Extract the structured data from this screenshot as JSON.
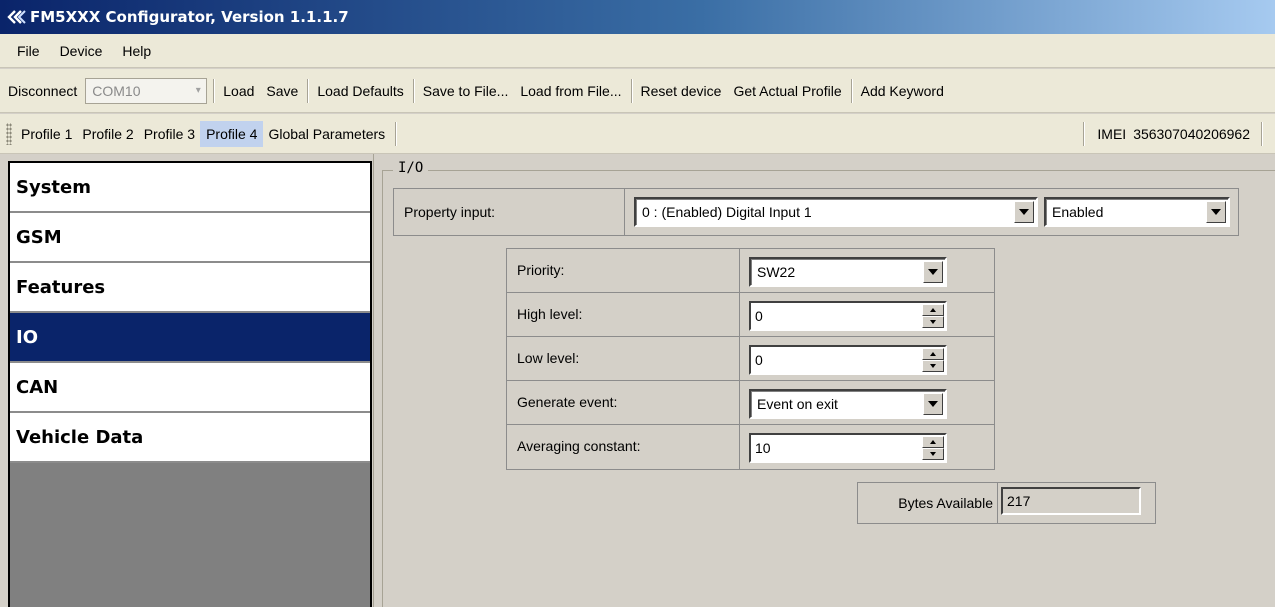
{
  "window": {
    "title": "FM5XXX Configurator, Version 1.1.1.7",
    "icon": "double-chevron-logo-icon"
  },
  "menu": {
    "items": [
      "File",
      "Device",
      "Help"
    ]
  },
  "toolbar": {
    "disconnect": "Disconnect",
    "port": "COM10",
    "load": "Load",
    "save": "Save",
    "load_defaults": "Load Defaults",
    "save_to_file": "Save to File...",
    "load_from_file": "Load from File...",
    "reset_device": "Reset device",
    "get_actual_profile": "Get Actual Profile",
    "add_keyword": "Add Keyword"
  },
  "profiles": {
    "items": [
      "Profile 1",
      "Profile 2",
      "Profile 3",
      "Profile 4",
      "Global Parameters"
    ],
    "active": "Profile 4",
    "imei_label": "IMEI",
    "imei_value": "356307040206962"
  },
  "sidebar": {
    "items": [
      "System",
      "GSM",
      "Features",
      "IO",
      "CAN",
      "Vehicle Data"
    ],
    "selected": "IO",
    "selected_color": "#0a246a"
  },
  "io": {
    "group_title": "I/O",
    "property_input_label": "Property input:",
    "property_input_value": "0 : (Enabled) Digital Input 1",
    "enabled_value": "Enabled",
    "params": [
      {
        "label": "Priority:",
        "value": "SW22",
        "control": "dropdown"
      },
      {
        "label": "High level:",
        "value": "0",
        "control": "spinner"
      },
      {
        "label": "Low level:",
        "value": "0",
        "control": "spinner"
      },
      {
        "label": "Generate event:",
        "value": "Event on exit",
        "control": "dropdown"
      },
      {
        "label": "Averaging constant:",
        "value": "10",
        "control": "spinner"
      }
    ],
    "bytes_available_label": "Bytes Available",
    "bytes_available_value": "217"
  }
}
